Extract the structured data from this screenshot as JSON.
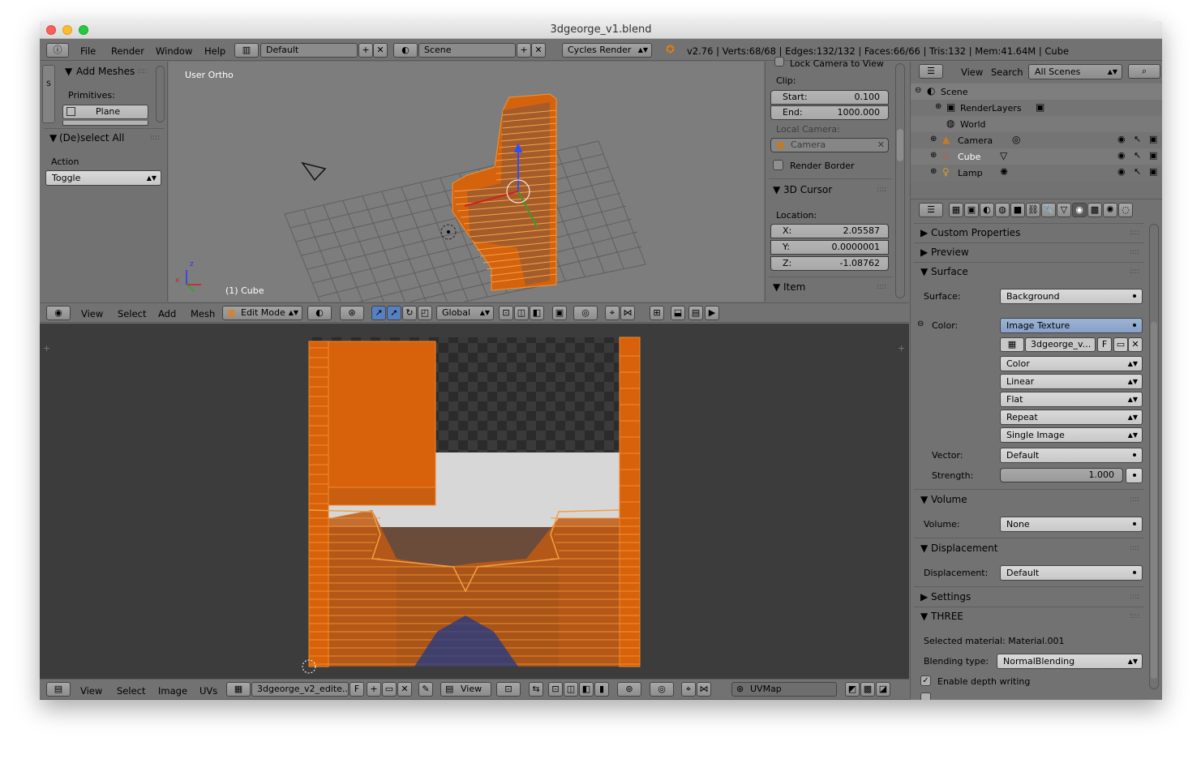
{
  "window": {
    "title": "3dgeorge_v1.blend"
  },
  "info_header": {
    "menus": [
      "File",
      "Render",
      "Window",
      "Help"
    ],
    "layout": "Default",
    "scene": "Scene",
    "engine": "Cycles Render",
    "stats": "v2.76 | Verts:68/68 | Edges:132/132 | Faces:66/66 | Tris:132 | Mem:41.64M | Cube"
  },
  "toolshelf": {
    "tab": "S",
    "add_meshes": "Add Meshes",
    "primitives_label": "Primitives:",
    "plane_label": "Plane",
    "deselect_title": "(De)select All",
    "action_label": "Action",
    "action_value": "Toggle"
  },
  "viewport": {
    "view_label": "User Ortho",
    "object_label": "(1) Cube",
    "axis_x": "x",
    "axis_z": "z"
  },
  "n_panel": {
    "lock_camera": "Lock Camera to View",
    "clip_label": "Clip:",
    "start_label": "Start:",
    "start_value": "0.100",
    "end_label": "End:",
    "end_value": "1000.000",
    "local_camera_label": "Local Camera:",
    "camera_field": "Camera",
    "render_border": "Render Border",
    "cursor_title": "3D Cursor",
    "location_label": "Location:",
    "x_label": "X:",
    "x_value": "2.05587",
    "y_label": "Y:",
    "y_value": "0.0000001",
    "z_label": "Z:",
    "z_value": "-1.08762",
    "item_title": "Item"
  },
  "view3d_header": {
    "menus": [
      "View",
      "Select",
      "Add",
      "Mesh"
    ],
    "mode": "Edit Mode",
    "orientation": "Global"
  },
  "outliner": {
    "menus": [
      "View",
      "Search"
    ],
    "filter": "All Scenes",
    "items": [
      {
        "label": "Scene"
      },
      {
        "label": "RenderLayers"
      },
      {
        "label": "World"
      },
      {
        "label": "Camera"
      },
      {
        "label": "Cube"
      },
      {
        "label": "Lamp"
      }
    ]
  },
  "properties": {
    "custom_properties": "Custom Properties",
    "preview": "Preview",
    "surface_title": "Surface",
    "surface_label": "Surface:",
    "surface_value": "Background",
    "color_label": "Color:",
    "color_value": "Image Texture",
    "image_name": "3dgeorge_v...",
    "image_f": "F",
    "opt_color": "Color",
    "opt_linear": "Linear",
    "opt_flat": "Flat",
    "opt_repeat": "Repeat",
    "opt_single": "Single Image",
    "vector_label": "Vector:",
    "vector_value": "Default",
    "strength_label": "Strength:",
    "strength_value": "1.000",
    "volume_title": "Volume",
    "volume_label": "Volume:",
    "volume_value": "None",
    "displacement_title": "Displacement",
    "displacement_label": "Displacement:",
    "displacement_value": "Default",
    "settings_title": "Settings",
    "three_title": "THREE",
    "selected_material": "Selected material: Material.001",
    "blending_label": "Blending type:",
    "blending_value": "NormalBlending",
    "depth_writing": "Enable depth writing"
  },
  "uv_header": {
    "menus": [
      "View",
      "Select",
      "Image",
      "UVs"
    ],
    "image_name": "3dgeorge_v2_edite...",
    "image_f": "F",
    "view_value": "View",
    "uvmap": "UVMap"
  }
}
